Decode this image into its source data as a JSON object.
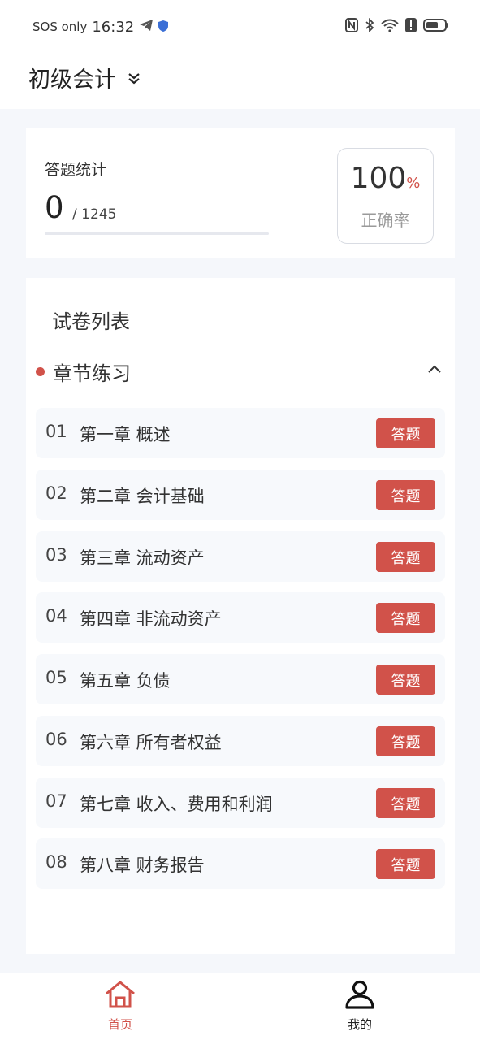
{
  "status_bar": {
    "carrier": "SOS only",
    "time": "16:32",
    "icons": [
      "telegram-icon",
      "shield-icon",
      "nfc-icon",
      "bluetooth-icon",
      "wifi-icon",
      "alert-icon",
      "battery-icon"
    ]
  },
  "header": {
    "title": "初级会计",
    "dropdown_icon": "double-chevron-down-icon"
  },
  "stats": {
    "label": "答题统计",
    "done": "0",
    "total": "/ 1245",
    "progress": 0,
    "accuracy_value": "100",
    "accuracy_unit": "%",
    "accuracy_label": "正确率"
  },
  "list": {
    "title": "试卷列表",
    "section_title": "章节练习",
    "section_expanded": true,
    "answer_label": "答题",
    "chapters": [
      {
        "num": "01",
        "name": "第一章 概述"
      },
      {
        "num": "02",
        "name": "第二章 会计基础"
      },
      {
        "num": "03",
        "name": "第三章 流动资产"
      },
      {
        "num": "04",
        "name": "第四章 非流动资产"
      },
      {
        "num": "05",
        "name": "第五章 负债"
      },
      {
        "num": "06",
        "name": "第六章 所有者权益"
      },
      {
        "num": "07",
        "name": "第七章 收入、费用和利润"
      },
      {
        "num": "08",
        "name": "第八章 财务报告"
      }
    ]
  },
  "tabbar": {
    "home_label": "首页",
    "mine_label": "我的"
  },
  "colors": {
    "accent": "#d1524a",
    "background": "#f5f7fb",
    "card": "#ffffff",
    "row": "#f7f9fc"
  }
}
